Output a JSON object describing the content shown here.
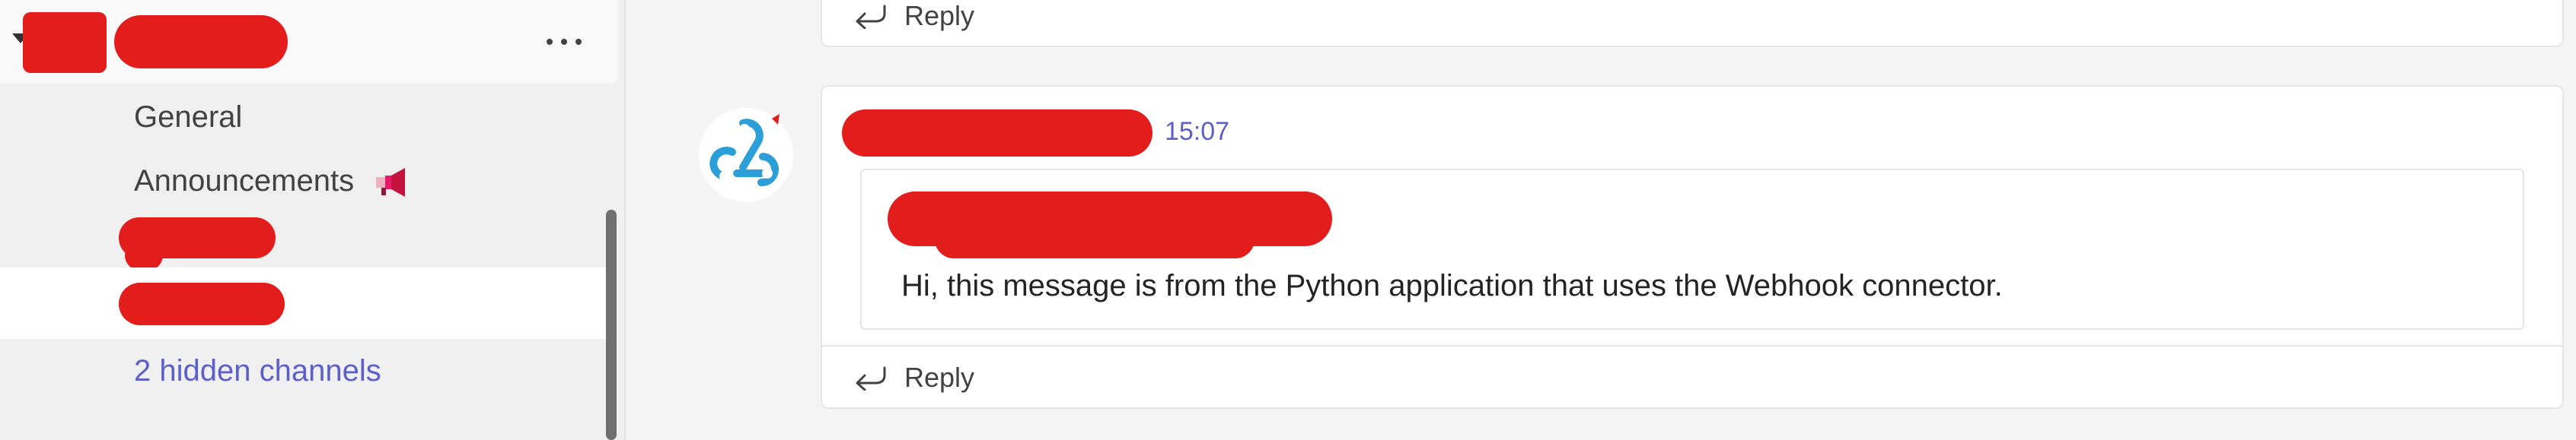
{
  "sidebar": {
    "channels": [
      {
        "label": "General"
      },
      {
        "label": "Announcements"
      },
      {
        "label": "2 hidden channels"
      }
    ]
  },
  "conversation": {
    "previous_message": {
      "reply_label": "Reply"
    },
    "message": {
      "time": "15:07",
      "body": "Hi, this message is from the Python application that uses the Webhook connector.",
      "reply_label": "Reply"
    }
  },
  "icons": {
    "avatar": "webhook-icon",
    "more": "more-options-icon",
    "reply": "reply-arrow-icon",
    "announcement": "megaphone-icon"
  },
  "colors": {
    "accent": "#5b5fc7",
    "webhook": "#2d9fd8",
    "redaction": "#e31c1c"
  }
}
